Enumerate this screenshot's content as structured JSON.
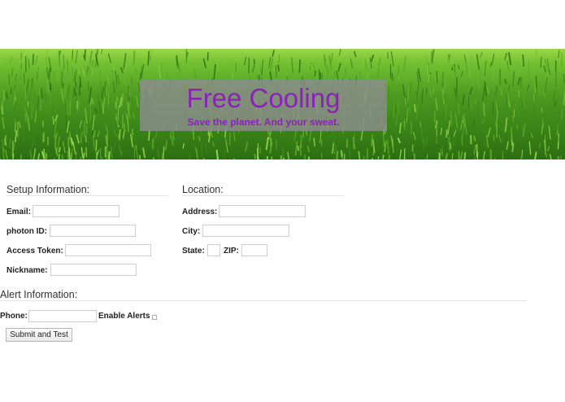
{
  "hero": {
    "title": "Free Cooling",
    "subtitle": "Save the planet. And your sweat."
  },
  "setup": {
    "heading": "Setup Information:",
    "email_label": "Email:",
    "photon_label": "photon ID:",
    "token_label": "Access Token:",
    "nickname_label": "Nickname:"
  },
  "location": {
    "heading": "Location:",
    "address_label": "Address:",
    "city_label": "City:",
    "state_label": "State:",
    "zip_label": "ZIP:"
  },
  "alert": {
    "heading": "Alert Information:",
    "phone_label": "Phone:",
    "enable_label": "Enable Alerts",
    "enabled": false
  },
  "submit_label": "Submit and Test",
  "colors": {
    "title_purple": "#8a22b8",
    "grass_green": "#4f9c22"
  }
}
